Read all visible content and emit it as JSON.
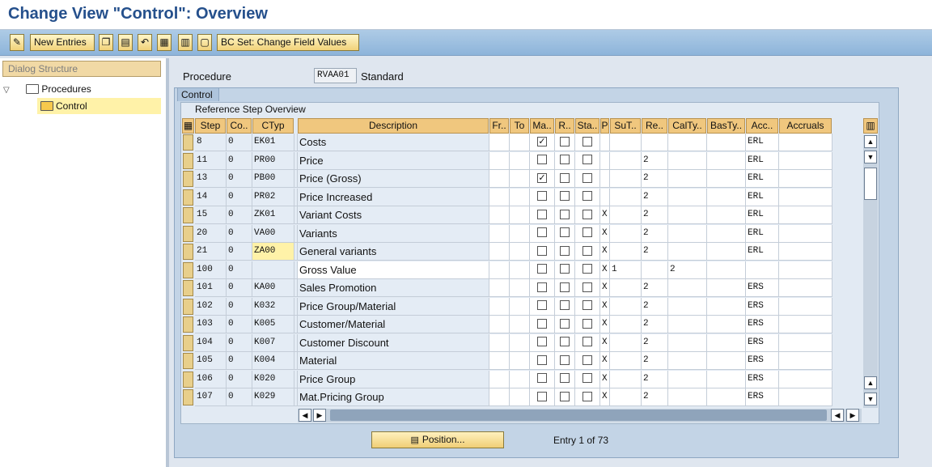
{
  "title": "Change View \"Control\": Overview",
  "toolbar": {
    "new_entries": "New Entries",
    "bc_set": "BC Set: Change Field Values"
  },
  "dialog": {
    "header": "Dialog Structure",
    "procedures": "Procedures",
    "control": "Control"
  },
  "procedure": {
    "label": "Procedure",
    "value": "RVAA01",
    "description": "Standard"
  },
  "control": {
    "tab": "Control",
    "section": "Reference Step Overview"
  },
  "columns": {
    "step": "Step",
    "co": "Co..",
    "ctyp": "CTyp",
    "description": "Description",
    "fr": "Fr..",
    "to": "To",
    "ma": "Ma..",
    "r": "R..",
    "sta": "Sta..",
    "p": "P",
    "sut": "SuT..",
    "re": "Re..",
    "calty": "CalTy..",
    "basty": "BasTy..",
    "acc": "Acc..",
    "accruals": "Accruals"
  },
  "rows": [
    {
      "step": "8",
      "co": "0",
      "ctyp": "EK01",
      "desc": "Costs",
      "ma": true,
      "p": "",
      "sut": "",
      "re": "",
      "calty": "",
      "acc": "ERL"
    },
    {
      "step": "11",
      "co": "0",
      "ctyp": "PR00",
      "desc": "Price",
      "ma": false,
      "p": "",
      "sut": "",
      "re": "2",
      "calty": "",
      "acc": "ERL"
    },
    {
      "step": "13",
      "co": "0",
      "ctyp": "PB00",
      "desc": "Price (Gross)",
      "ma": true,
      "p": "",
      "sut": "",
      "re": "2",
      "calty": "",
      "acc": "ERL"
    },
    {
      "step": "14",
      "co": "0",
      "ctyp": "PR02",
      "desc": "Price Increased",
      "ma": false,
      "p": "",
      "sut": "",
      "re": "2",
      "calty": "",
      "acc": "ERL"
    },
    {
      "step": "15",
      "co": "0",
      "ctyp": "ZK01",
      "desc": "Variant Costs",
      "ma": false,
      "p": "X",
      "sut": "",
      "re": "2",
      "calty": "",
      "acc": "ERL"
    },
    {
      "step": "20",
      "co": "0",
      "ctyp": "VA00",
      "desc": "Variants",
      "ma": false,
      "p": "X",
      "sut": "",
      "re": "2",
      "calty": "",
      "acc": "ERL"
    },
    {
      "step": "21",
      "co": "0",
      "ctyp": "ZA00",
      "desc": "General variants",
      "ma": false,
      "p": "X",
      "sut": "",
      "re": "2",
      "calty": "",
      "acc": "ERL"
    },
    {
      "step": "100",
      "co": "0",
      "ctyp": "",
      "desc": "Gross Value",
      "ma": false,
      "p": "X",
      "sut": "1",
      "re": "",
      "calty": "2",
      "acc": ""
    },
    {
      "step": "101",
      "co": "0",
      "ctyp": "KA00",
      "desc": "Sales Promotion",
      "ma": false,
      "p": "X",
      "sut": "",
      "re": "2",
      "calty": "",
      "acc": "ERS"
    },
    {
      "step": "102",
      "co": "0",
      "ctyp": "K032",
      "desc": "Price Group/Material",
      "ma": false,
      "p": "X",
      "sut": "",
      "re": "2",
      "calty": "",
      "acc": "ERS"
    },
    {
      "step": "103",
      "co": "0",
      "ctyp": "K005",
      "desc": "Customer/Material",
      "ma": false,
      "p": "X",
      "sut": "",
      "re": "2",
      "calty": "",
      "acc": "ERS"
    },
    {
      "step": "104",
      "co": "0",
      "ctyp": "K007",
      "desc": "Customer Discount",
      "ma": false,
      "p": "X",
      "sut": "",
      "re": "2",
      "calty": "",
      "acc": "ERS"
    },
    {
      "step": "105",
      "co": "0",
      "ctyp": "K004",
      "desc": "Material",
      "ma": false,
      "p": "X",
      "sut": "",
      "re": "2",
      "calty": "",
      "acc": "ERS"
    },
    {
      "step": "106",
      "co": "0",
      "ctyp": "K020",
      "desc": "Price Group",
      "ma": false,
      "p": "X",
      "sut": "",
      "re": "2",
      "calty": "",
      "acc": "ERS"
    },
    {
      "step": "107",
      "co": "0",
      "ctyp": "K029",
      "desc": "Mat.Pricing Group",
      "ma": false,
      "p": "X",
      "sut": "",
      "re": "2",
      "calty": "",
      "acc": "ERS"
    }
  ],
  "position_button": "Position...",
  "entry_info": "Entry 1 of 73",
  "icons": [
    "pencil-icon",
    "copy-icon",
    "save-icon",
    "undo-icon",
    "select-all-icon",
    "select-block-icon",
    "deselect-icon",
    "table-settings-icon",
    "position-icon"
  ]
}
